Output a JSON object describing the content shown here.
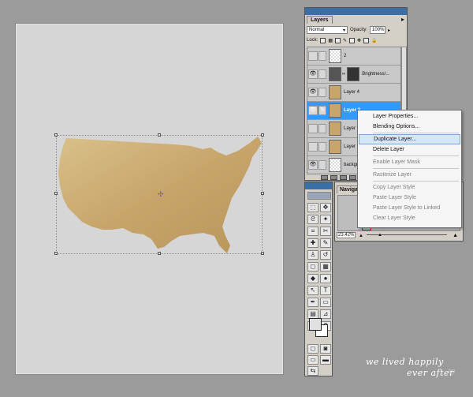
{
  "layers_panel": {
    "tab_label": "Layers",
    "blend_mode": "Normal",
    "opacity_label": "Opacity:",
    "opacity_value": "100%",
    "lock_label": "Lock:",
    "layers": [
      {
        "name": "2",
        "visible": false,
        "selected": false,
        "thumb": "check",
        "mask": false
      },
      {
        "name": "Brightness/...",
        "visible": true,
        "selected": false,
        "thumb": "check",
        "mask": true
      },
      {
        "name": "Layer 4",
        "visible": true,
        "selected": false,
        "thumb": "map",
        "mask": false
      },
      {
        "name": "Layer 2",
        "visible": true,
        "selected": true,
        "thumb": "map",
        "mask": false
      },
      {
        "name": "Layer 3",
        "visible": false,
        "selected": false,
        "thumb": "map",
        "mask": false
      },
      {
        "name": "Layer 1",
        "visible": false,
        "selected": false,
        "thumb": "map",
        "mask": false
      },
      {
        "name": "backgro",
        "visible": true,
        "selected": false,
        "thumb": "check",
        "mask": false
      }
    ]
  },
  "context_menu": {
    "items": [
      {
        "label": "Layer Properties...",
        "enabled": true
      },
      {
        "label": "Blending Options...",
        "enabled": true
      },
      {
        "separator": true
      },
      {
        "label": "Duplicate Layer...",
        "enabled": true,
        "hover": true
      },
      {
        "label": "Delete Layer",
        "enabled": true
      },
      {
        "separator": true
      },
      {
        "label": "Enable Layer Mask",
        "enabled": false
      },
      {
        "separator": true
      },
      {
        "label": "Rasterize Layer",
        "enabled": false
      },
      {
        "separator": true
      },
      {
        "label": "Copy Layer Style",
        "enabled": false
      },
      {
        "label": "Paste Layer Style",
        "enabled": false
      },
      {
        "label": "Paste Layer Style to Linked",
        "enabled": false
      },
      {
        "label": "Clear Layer Style",
        "enabled": false
      }
    ]
  },
  "navigator_panel": {
    "tab_label": "Navigat",
    "zoom_value": "23.42%"
  },
  "toolbox": {
    "tools": [
      "marquee-tool",
      "move-tool",
      "lasso-tool",
      "magic-wand-tool",
      "crop-tool",
      "slice-tool",
      "healing-brush-tool",
      "brush-tool",
      "clone-stamp-tool",
      "history-brush-tool",
      "eraser-tool",
      "gradient-tool",
      "blur-tool",
      "dodge-tool",
      "path-selection-tool",
      "type-tool",
      "pen-tool",
      "shape-tool",
      "notes-tool",
      "eyedropper-tool",
      "hand-tool",
      "zoom-tool"
    ],
    "glyphs": [
      "⬚",
      "✥",
      "ᘓ",
      "✦",
      "⌗",
      "✂",
      "✚",
      "✎",
      "♙",
      "↺",
      "◻",
      "▦",
      "◆",
      "●",
      "↖",
      "T",
      "✒",
      "▭",
      "▤",
      "⊿",
      "✋",
      "⚲"
    ]
  },
  "watermark": {
    "line1": "we lived happily",
    "line2": "ever after"
  },
  "colors": {
    "canvas_bg": "#d6d6d6",
    "workspace_bg": "#9b9b9b",
    "selection_blue": "#3399ff",
    "map_gold": "#c8a56b",
    "palette_gray": "#d4d0c8"
  }
}
